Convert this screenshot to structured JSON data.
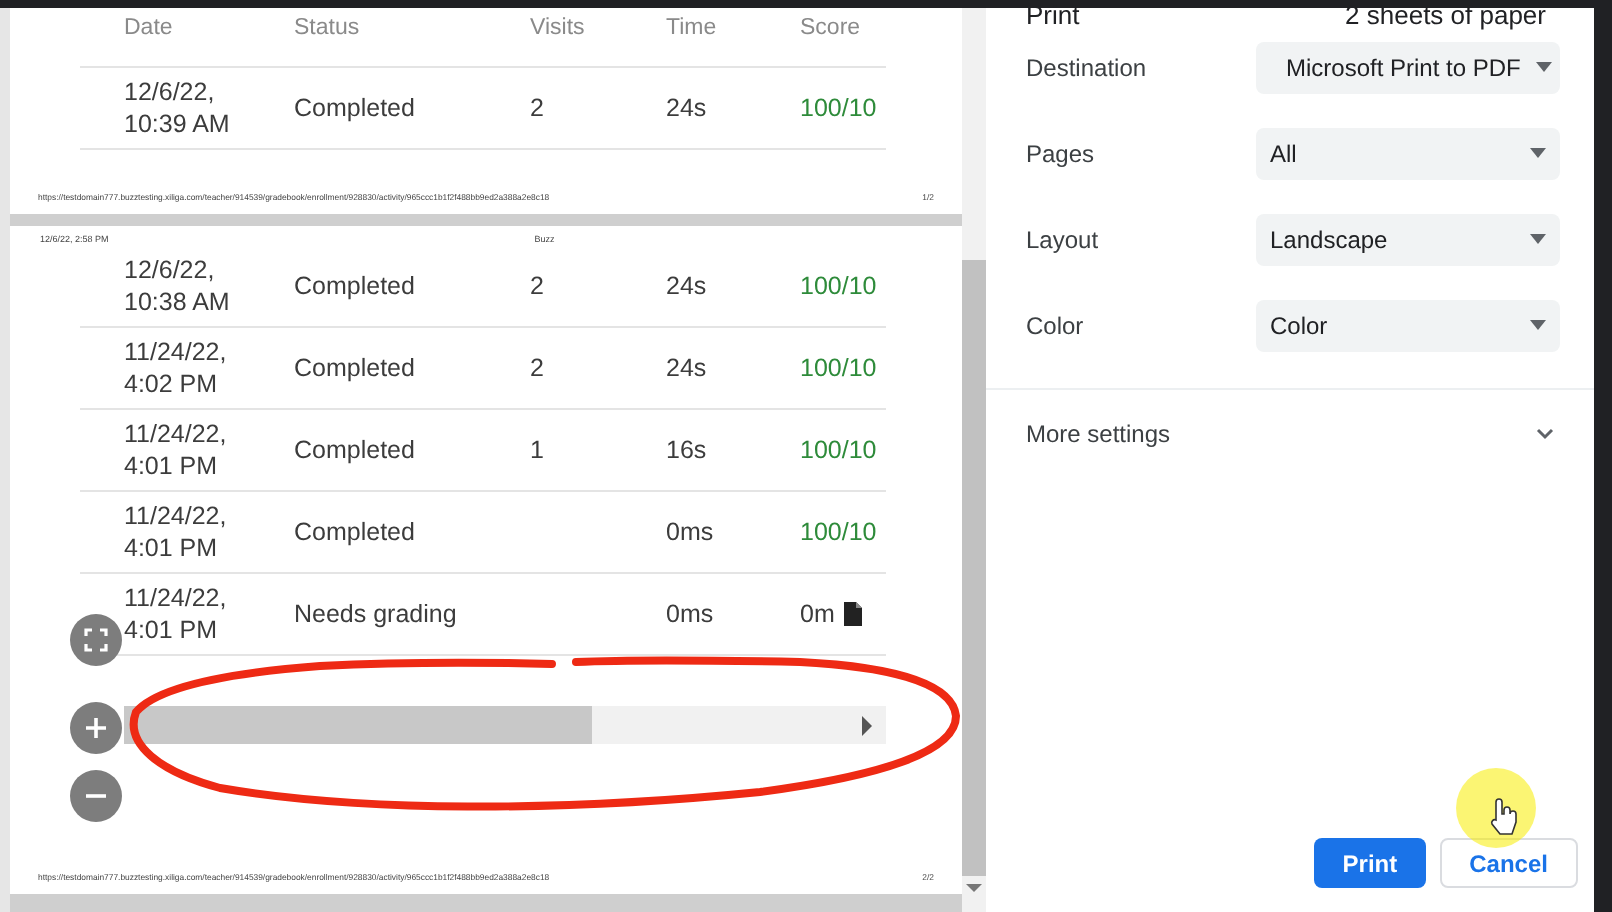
{
  "preview": {
    "pages": [
      {
        "columns": [
          "Date",
          "Status",
          "Visits",
          "Time",
          "Score"
        ],
        "rows": [
          {
            "date": "12/6/22, 10:39 AM",
            "status": "Completed",
            "visits": "2",
            "time": "24s",
            "score": "100/10",
            "graded": true
          }
        ],
        "footer_url": "https://testdomain777.buzztesting.xiliga.com/teacher/914539/gradebook/enrollment/928830/activity/965ccc1b1f2f488bb9ed2a388a2e8c18",
        "page_number": "1/2"
      },
      {
        "header_date": "12/6/22, 2:58 PM",
        "header_title": "Buzz",
        "rows": [
          {
            "date": "12/6/22, 10:38 AM",
            "status": "Completed",
            "visits": "2",
            "time": "24s",
            "score": "100/10",
            "graded": true
          },
          {
            "date": "11/24/22, 4:02 PM",
            "status": "Completed",
            "visits": "2",
            "time": "24s",
            "score": "100/10",
            "graded": true
          },
          {
            "date": "11/24/22, 4:01 PM",
            "status": "Completed",
            "visits": "1",
            "time": "16s",
            "score": "100/10",
            "graded": true
          },
          {
            "date": "11/24/22, 4:01 PM",
            "status": "Completed",
            "time": "0ms",
            "score": "100/10",
            "graded": true
          },
          {
            "date": "11/24/22, 4:01 PM",
            "status": "Needs grading",
            "time": "0ms",
            "score": "0m",
            "graded": false
          }
        ],
        "footer_url": "https://testdomain777.buzztesting.xiliga.com/teacher/914539/gradebook/enrollment/928830/activity/965ccc1b1f2f488bb9ed2a388a2e8c18",
        "page_number": "2/2"
      }
    ]
  },
  "settings": {
    "title": "Print",
    "summary": "2 sheets of paper",
    "fields": [
      {
        "label": "Destination",
        "value": "Microsoft Print to PDF",
        "kind": "printer"
      },
      {
        "label": "Pages",
        "value": "All",
        "kind": "plain"
      },
      {
        "label": "Layout",
        "value": "Landscape",
        "kind": "plain"
      },
      {
        "label": "Color",
        "value": "Color",
        "kind": "plain"
      }
    ],
    "more_settings": "More settings",
    "buttons": [
      {
        "label": "Print",
        "kind": "primary"
      },
      {
        "label": "Cancel",
        "kind": "secondary"
      }
    ]
  }
}
